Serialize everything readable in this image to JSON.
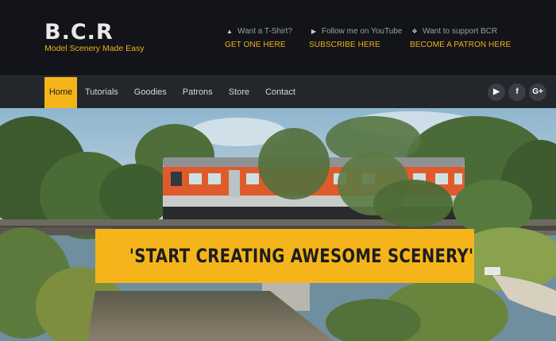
{
  "brand": {
    "title": "B.C.R",
    "tagline": "Model Scenery Made Easy"
  },
  "header_ctas": [
    {
      "icon": "shirt-icon",
      "prompt": "Want a T-Shirt?",
      "action": "GET ONE HERE"
    },
    {
      "icon": "youtube-icon",
      "prompt": "Follow me on YouTube",
      "action": "SUBSCRIBE HERE"
    },
    {
      "icon": "gavel-icon",
      "prompt": "Want to support BCR",
      "action": "BECOME A PATRON HERE"
    }
  ],
  "nav": {
    "items": [
      "Home",
      "Tutorials",
      "Goodies",
      "Patrons",
      "Store",
      "Contact"
    ],
    "active": "Home"
  },
  "social": [
    {
      "icon": "youtube-icon",
      "glyph": "▶"
    },
    {
      "icon": "facebook-icon",
      "glyph": "f"
    },
    {
      "icon": "google-plus-icon",
      "glyph": "G+"
    }
  ],
  "hero": {
    "headline": "'START CREATING AWESOME SCENERY'"
  },
  "colors": {
    "accent": "#f5b51a",
    "header_bg": "#121419",
    "nav_bg": "#23262b"
  }
}
